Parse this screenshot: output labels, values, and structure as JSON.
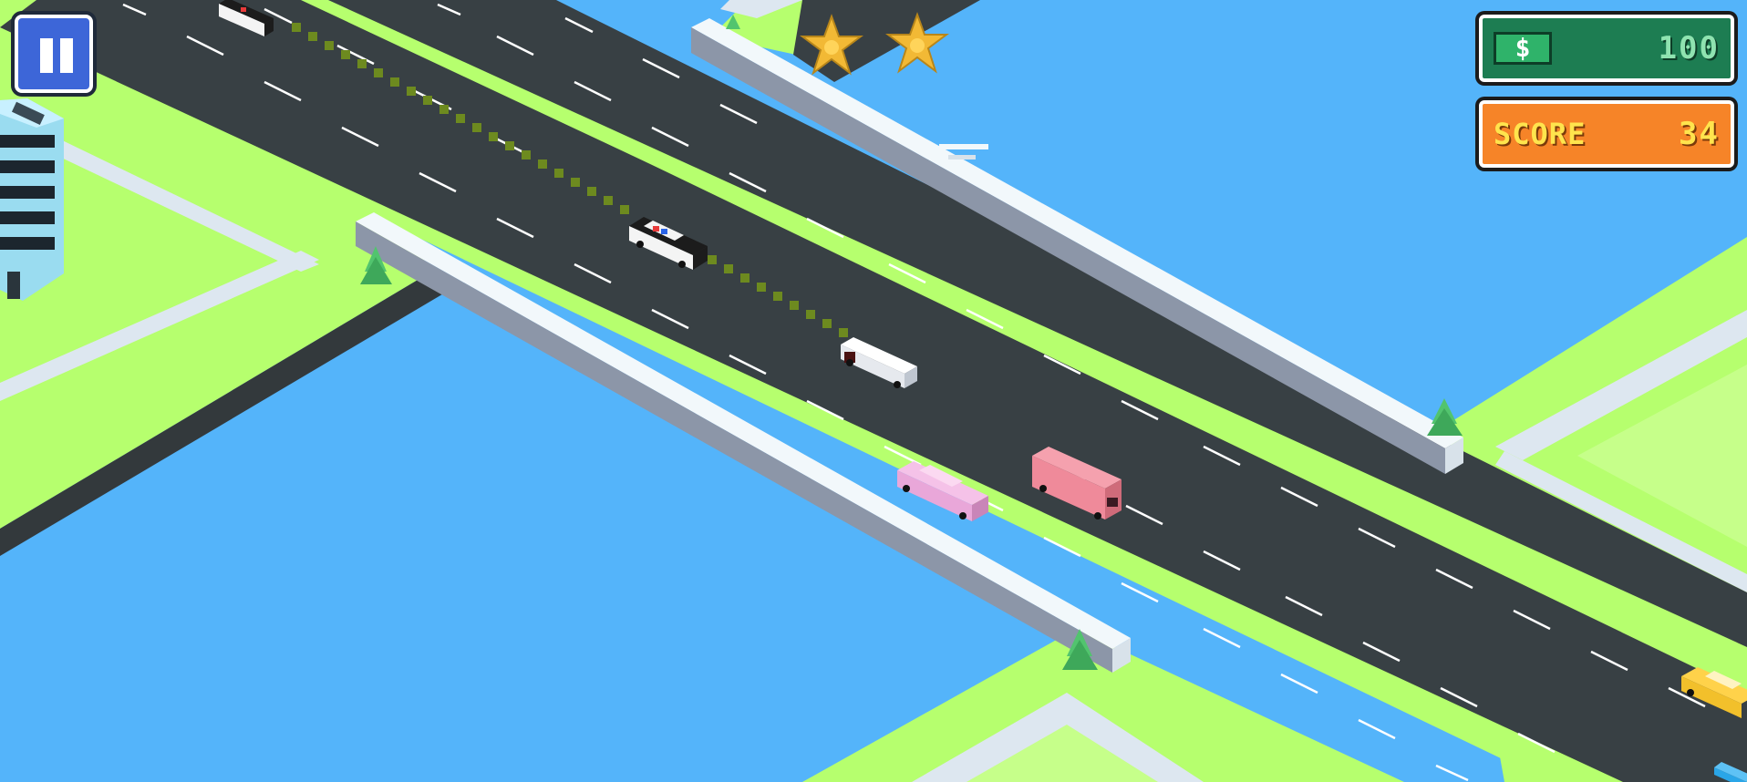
{
  "hud": {
    "pause_icon": "pause-icon",
    "money": {
      "icon_symbol": "$",
      "value": "100"
    },
    "score": {
      "label": "SCORE",
      "value": "34"
    },
    "wanted_stars": 2
  },
  "colors": {
    "water": "#54b4fa",
    "grass": "#b6ff6e",
    "road": "#384044",
    "lane_marking": "#ffffff",
    "money_panel": "#1d7d52",
    "score_panel": "#f68428",
    "score_text": "#ffe44d",
    "pause_button": "#3d66d8",
    "star": "#f2b935"
  },
  "vehicles": [
    "police-car",
    "police-car",
    "white-truck",
    "pink-car",
    "pink-van",
    "yellow-car",
    "blue-car"
  ]
}
